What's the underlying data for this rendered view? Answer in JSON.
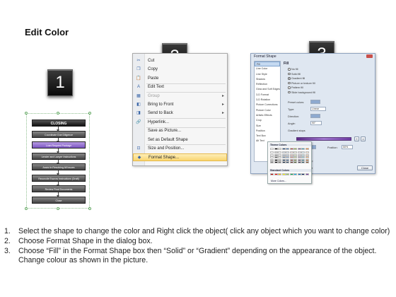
{
  "title": "Edit Color",
  "badges": [
    "1",
    "2",
    "3"
  ],
  "flowchart": {
    "boxes": [
      "CLOSING",
      "Coordinate Due Diligence",
      "Loan Request Package",
      "Lender and Lawyer Instructions",
      "Assist in Resolving All Issues",
      "Reconcile Escrow Instructions (Draft)",
      "Review Final Documents",
      "Close"
    ],
    "selected_index": 2
  },
  "context_menu": {
    "items": [
      {
        "label": "Cut",
        "icon": "cut-icon",
        "glyph": "✂",
        "enabled": true
      },
      {
        "label": "Copy",
        "icon": "copy-icon",
        "glyph": "❐",
        "enabled": true
      },
      {
        "label": "Paste",
        "icon": "paste-icon",
        "glyph": "📋",
        "enabled": true
      },
      {
        "label": "Edit Text",
        "icon": "edit-text-icon",
        "glyph": "A",
        "enabled": true
      },
      {
        "label": "Group",
        "icon": "group-icon",
        "glyph": "▦",
        "enabled": false,
        "submenu": true
      },
      {
        "label": "Bring to Front",
        "icon": "bring-to-front-icon",
        "glyph": "◧",
        "enabled": true,
        "submenu": true
      },
      {
        "label": "Send to Back",
        "icon": "send-to-back-icon",
        "glyph": "◨",
        "enabled": true,
        "submenu": true
      },
      {
        "label": "Hyperlink...",
        "icon": "hyperlink-icon",
        "glyph": "🔗",
        "enabled": true
      },
      {
        "label": "Save as Picture...",
        "icon": "",
        "glyph": "",
        "enabled": true
      },
      {
        "label": "Set as Default Shape",
        "icon": "",
        "glyph": "",
        "enabled": true
      },
      {
        "label": "Size and Position...",
        "icon": "size-position-icon",
        "glyph": "⊡",
        "enabled": true
      },
      {
        "label": "Format Shape...",
        "icon": "format-shape-icon",
        "glyph": "◆",
        "enabled": true,
        "highlighted": true
      }
    ]
  },
  "dialog": {
    "title": "Format Shape",
    "nav": [
      "Fill",
      "Line Color",
      "Line Style",
      "Shadow",
      "Reflection",
      "Glow and Soft Edges",
      "3-D Format",
      "3-D Rotation",
      "Picture Corrections",
      "Picture Color",
      "Artistic Effects",
      "Crop",
      "Size",
      "Position",
      "Text Box",
      "Alt Text"
    ],
    "active_nav": "Fill",
    "section": "Fill",
    "fill_options": [
      "No fill",
      "Solid fill",
      "Gradient fill",
      "Picture or texture fill",
      "Pattern fill",
      "Slide background fill"
    ],
    "selected_fill": "Gradient fill",
    "preset_colors_label": "Preset colors:",
    "type_label": "Type:",
    "type_value": "Linear",
    "direction_label": "Direction:",
    "angle_label": "Angle:",
    "angle_value": "90°",
    "gradient_stops_label": "Gradient stops",
    "color_label": "Color",
    "position_label": "Position:",
    "position_value": "50%",
    "brightness_label": "Brightness:",
    "transparency_label": "Transparency:",
    "rotate_label": "Rotate with shape",
    "close_label": "Close"
  },
  "color_picker": {
    "theme_header": "Theme Colors",
    "standard_header": "Standard Colors",
    "more_label": "More Colors...",
    "theme_top": [
      "#ffffff",
      "#000000",
      "#eeece1",
      "#1f497d",
      "#4f81bd",
      "#c0504d",
      "#9bbb59",
      "#8064a2",
      "#4bacc6",
      "#f79646"
    ],
    "standard": [
      "#c00000",
      "#ff0000",
      "#ffc000",
      "#ffff00",
      "#92d050",
      "#00b050",
      "#00b0f0",
      "#0070c0",
      "#002060",
      "#7030a0"
    ]
  },
  "steps": [
    {
      "num": "1.",
      "text": "Select the shape to change the color and Right click the object( click any object which you want to change color)"
    },
    {
      "num": "2.",
      "text": "Choose Format Shape in the dialog box."
    },
    {
      "num": "3.",
      "text": "Choose “Fill” in the Format Shape box then “Solid” or “Gradient” depending on the appearance of the object. Change colour as shown in the picture."
    }
  ]
}
